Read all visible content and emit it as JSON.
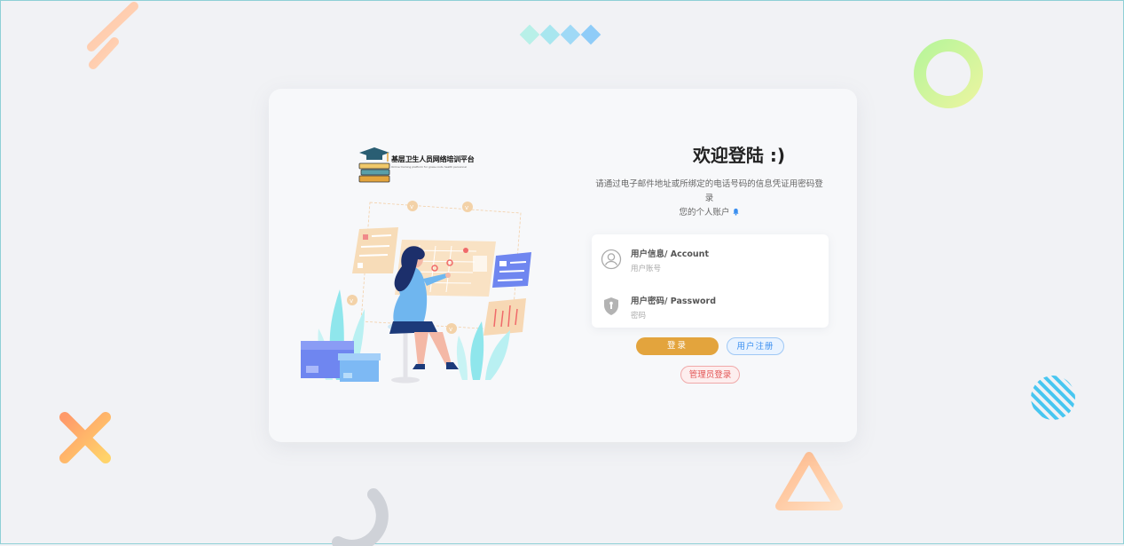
{
  "logo": {
    "title": "基层卫生人员网络培训平台",
    "subtitle": "Online training platform for grass-roots health personnel"
  },
  "welcome": {
    "title": "欢迎登陆 :)"
  },
  "description": {
    "line1": "请通过电子邮件地址或所绑定的电话号码的信息凭证用密码登录",
    "line2": "您的个人账户"
  },
  "form": {
    "account": {
      "label": "用户信息/ Account",
      "placeholder": "用户账号",
      "value": ""
    },
    "password": {
      "label": "用户密码/ Password",
      "placeholder": "密码",
      "value": ""
    }
  },
  "buttons": {
    "login": "登录",
    "register": "用户注册",
    "admin": "管理员登录"
  },
  "colors": {
    "login": "#e3a43d",
    "register": "#3b8ff0",
    "admin": "#e35555",
    "background": "#f1f2f5"
  },
  "icons": [
    "user-icon",
    "shield-icon",
    "bell-icon"
  ]
}
